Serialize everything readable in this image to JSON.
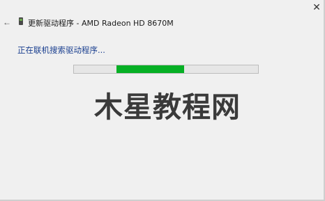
{
  "window": {
    "close_glyph": "✕",
    "back_glyph": "←",
    "title": "更新驱动程序 - AMD Radeon HD 8670M"
  },
  "main": {
    "status_text": "正在联机搜索驱动程序...",
    "progress": {
      "indeterminate": true,
      "segment_start_fraction": 0.23,
      "segment_end_fraction": 0.6,
      "color": "#06b025"
    }
  },
  "watermark": {
    "text": "木星教程网"
  }
}
